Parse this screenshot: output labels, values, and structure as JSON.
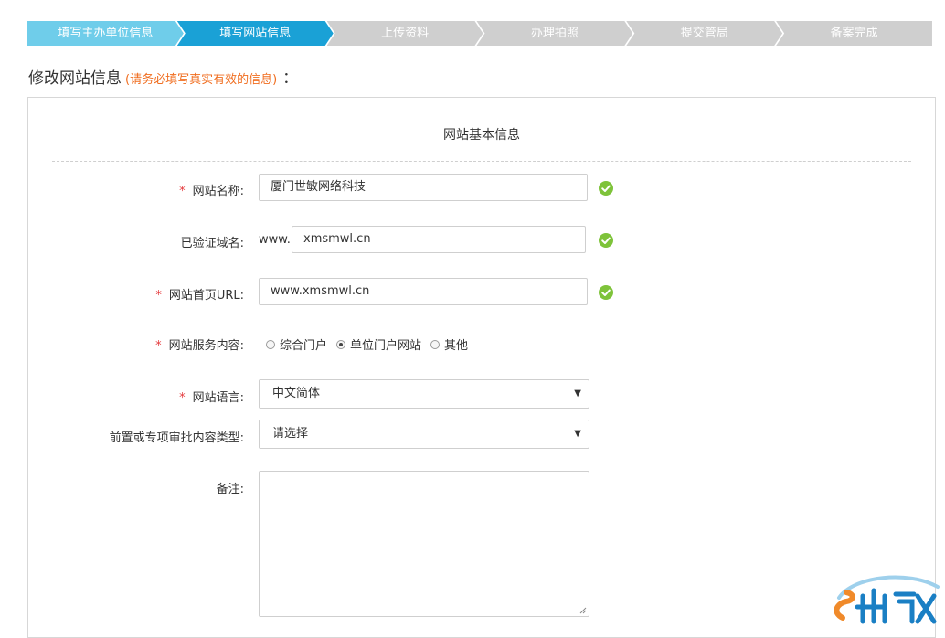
{
  "steps": [
    {
      "label": "填写主办单位信息",
      "state": "done"
    },
    {
      "label": "填写网站信息",
      "state": "active"
    },
    {
      "label": "上传资料",
      "state": "pending"
    },
    {
      "label": "办理拍照",
      "state": "pending"
    },
    {
      "label": "提交管局",
      "state": "pending"
    },
    {
      "label": "备案完成",
      "state": "pending"
    }
  ],
  "header": {
    "title": "修改网站信息",
    "note": "(请务必填写真实有效的信息)",
    "colon": "："
  },
  "panel": {
    "title": "网站基本信息"
  },
  "form": {
    "site_name": {
      "label": "网站名称:",
      "required": "*",
      "value": "厦门世敏网络科技"
    },
    "domain": {
      "label": "已验证域名:",
      "prefix": "www.",
      "value": "xmsmwl.cn"
    },
    "home_url": {
      "label": "网站首页URL:",
      "required": "*",
      "value": "www.xmsmwl.cn"
    },
    "service": {
      "label": "网站服务内容:",
      "required": "*",
      "options": [
        "综合门户",
        "单位门户网站",
        "其他"
      ],
      "selected": "单位门户网站"
    },
    "language": {
      "label": "网站语言:",
      "required": "*",
      "value": "中文简体"
    },
    "approval": {
      "label": "前置或专项审批内容类型:",
      "value": "请选择"
    },
    "remark": {
      "label": "备注:",
      "value": ""
    }
  },
  "colors": {
    "step_done": "#6fcdea",
    "step_active": "#1aa1d6",
    "step_pending": "#cfcfcf",
    "required": "#e4393c",
    "note": "#f06d1f",
    "ok": "#7ec33a"
  },
  "icons": {
    "valid": "check-circle-icon",
    "select_arrow": "caret-down-icon",
    "resize": "resize-handle-icon",
    "logo": "company-logo"
  }
}
